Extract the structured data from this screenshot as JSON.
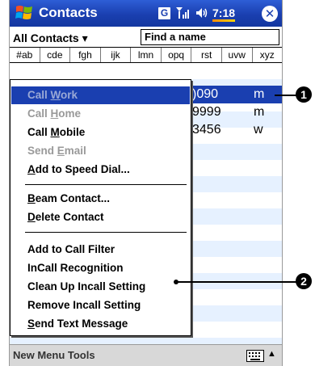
{
  "titlebar": {
    "title": "Contacts",
    "time": "7:18",
    "close": "✕"
  },
  "filter": {
    "category": "All Contacts",
    "search_placeholder": "Find a name"
  },
  "alphabet_tabs": [
    "#ab",
    "cde",
    "fgh",
    "ijk",
    "lmn",
    "opq",
    "rst",
    "uvw",
    "xyz"
  ],
  "contacts_visible": [
    {
      "number": ")090",
      "type": "m"
    },
    {
      "number": "9999",
      "type": "m"
    },
    {
      "number": "3456",
      "type": "w"
    }
  ],
  "context_menu": {
    "items": [
      {
        "label_pre": "Call ",
        "label_u": "W",
        "label_post": "ork",
        "state": "highlighted-disabled"
      },
      {
        "label_pre": "Call ",
        "label_u": "H",
        "label_post": "ome",
        "state": "disabled"
      },
      {
        "label_pre": "Call ",
        "label_u": "M",
        "label_post": "obile",
        "state": "enabled"
      },
      {
        "label_pre": "Send ",
        "label_u": "E",
        "label_post": "mail",
        "state": "disabled"
      },
      {
        "label_pre": "",
        "label_u": "A",
        "label_post": "dd to Speed Dial...",
        "state": "enabled"
      },
      {
        "label_pre": "",
        "label_u": "B",
        "label_post": "eam Contact...",
        "state": "enabled"
      },
      {
        "label_pre": "",
        "label_u": "D",
        "label_post": "elete Contact",
        "state": "enabled"
      },
      {
        "label_pre": "Add to Call Filter",
        "label_u": "",
        "label_post": "",
        "state": "enabled"
      },
      {
        "label_pre": "InCall Recognition",
        "label_u": "",
        "label_post": "",
        "state": "enabled"
      },
      {
        "label_pre": "Clean Up Incall Setting",
        "label_u": "",
        "label_post": "",
        "state": "enabled"
      },
      {
        "label_pre": "Remove Incall Setting",
        "label_u": "",
        "label_post": "",
        "state": "enabled"
      },
      {
        "label_pre": "",
        "label_u": "S",
        "label_post": "end Text Message",
        "state": "enabled"
      }
    ]
  },
  "bottom_bar": {
    "menu_text": "New  Menu  Tools"
  },
  "callouts": [
    "1",
    "2"
  ],
  "colors": {
    "title_bar": "#1a3fb0",
    "selection": "#1a3fb0",
    "list_stripe": "#e6f1ff"
  }
}
